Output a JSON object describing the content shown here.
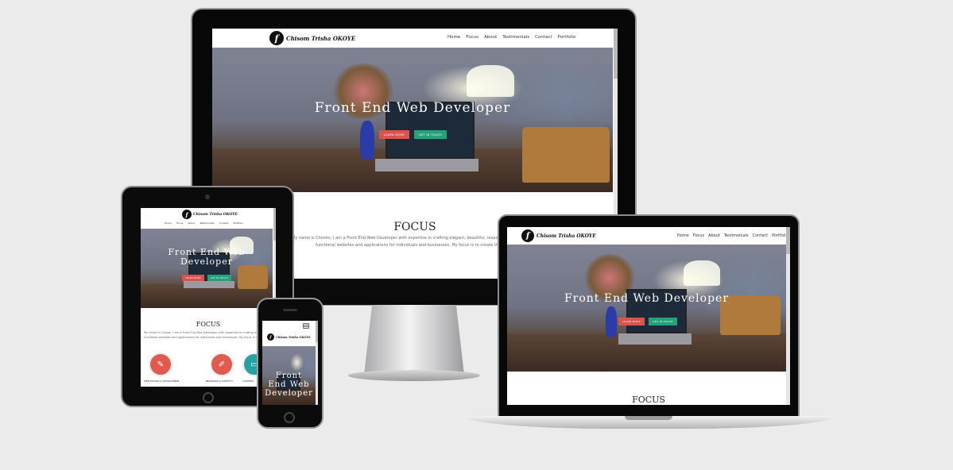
{
  "site": {
    "logo_mark": "f",
    "logo_text": "Chisom Trisha OKOYE",
    "nav": [
      "Home",
      "Focus",
      "About",
      "Testimonials",
      "Contact",
      "Portfolio"
    ],
    "hero_title": "Front End Web Developer",
    "hero_title_stacked": [
      "Front",
      "End Web",
      "Developer"
    ],
    "btn_learn": "LEARN MORE",
    "btn_touch": "GET IN TOUCH",
    "focus_heading": "FOCUS",
    "focus_text_1": "My name is Chisom, I am a Front End Web Developer with expertise in crafting elegant, beautiful, responsive and",
    "focus_text_2": "functional websites and applications for individuals and businesses. My focus is to create the best possible",
    "cards": [
      "WEB DESIGN & DEVELOPMENT",
      "BRANDING & IDENTITY",
      "CONTENT"
    ]
  },
  "colors": {
    "accent_red": "#d9534f",
    "accent_green": "#27a17a"
  },
  "icons": {
    "hamburger": "menu-icon",
    "card_1": "design-icon",
    "card_2": "pen-icon",
    "card_3": "monitor-icon"
  }
}
